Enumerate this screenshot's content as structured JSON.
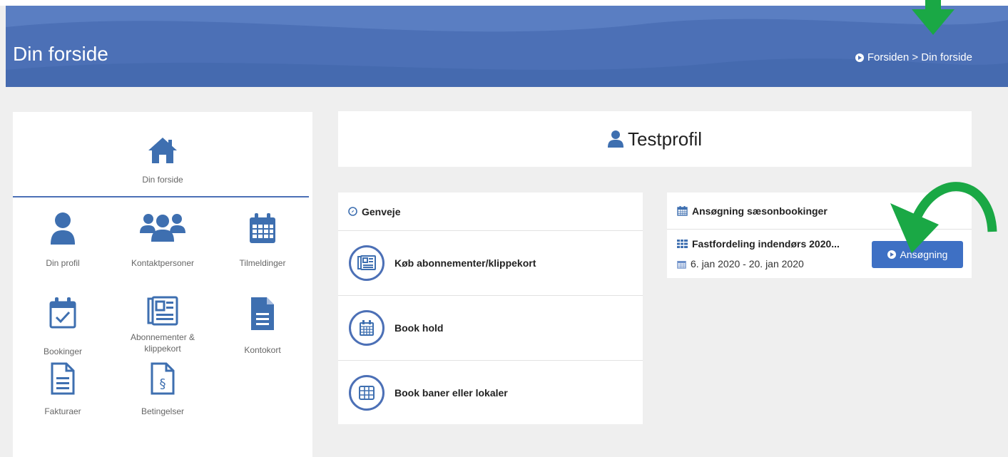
{
  "header": {
    "title": "Din forside",
    "breadcrumb": "Forsiden > Din forside"
  },
  "sidebar": {
    "home": {
      "label": "Din forside",
      "icon": "home-icon"
    },
    "items": [
      {
        "label": "Din profil",
        "icon": "user-icon"
      },
      {
        "label": "Kontaktpersoner",
        "icon": "users-icon"
      },
      {
        "label": "Tilmeldinger",
        "icon": "calendar-icon"
      },
      {
        "label": "Bookinger",
        "icon": "calendar-check-icon"
      },
      {
        "label": "Abonnementer & klippekort",
        "icon": "newspaper-icon"
      },
      {
        "label": "Kontokort",
        "icon": "document-icon"
      },
      {
        "label": "Fakturaer",
        "icon": "invoice-icon"
      },
      {
        "label": "Betingelser",
        "icon": "terms-icon"
      }
    ]
  },
  "profile": {
    "name": "Testprofil",
    "icon": "user-icon"
  },
  "shortcuts": {
    "title": "Genveje",
    "items": [
      {
        "label": "Køb abonnementer/klippekort",
        "icon": "newspaper-icon"
      },
      {
        "label": "Book hold",
        "icon": "calendar-icon"
      },
      {
        "label": "Book baner eller lokaler",
        "icon": "grid-icon"
      }
    ]
  },
  "season": {
    "title": "Ansøgning sæsonbookinger",
    "entry_title": "Fastfordeling indendørs 2020...",
    "entry_dates": "6. jan 2020 - 20. jan 2020",
    "button_label": "Ansøgning"
  },
  "colors": {
    "brand": "#4c70b6",
    "button": "#3e70c4",
    "annotation_arrow": "#1aa845"
  }
}
